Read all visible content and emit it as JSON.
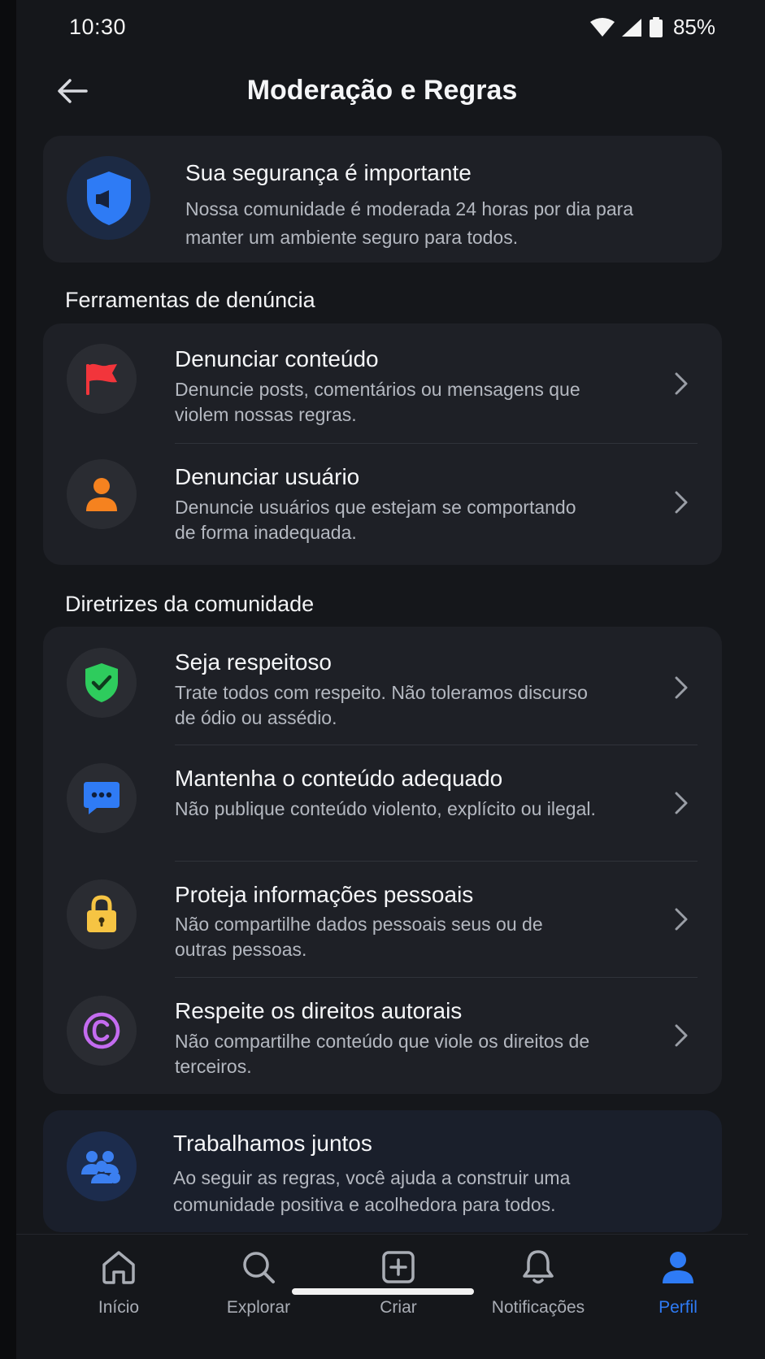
{
  "status_bar": {
    "time": "10:30",
    "battery": "85%"
  },
  "header": {
    "title": "Moderação e Regras",
    "back_icon": "arrow-left-icon"
  },
  "info_card": {
    "icon": "shield-icon",
    "title": "Sua segurança é importante",
    "description": "Nossa comunidade é moderada 24 horas por dia para manter um ambiente seguro para todos."
  },
  "report_section": {
    "title": "Ferramentas de denúncia",
    "items": [
      {
        "icon": "flag-icon",
        "icon_color": "#f2353b",
        "title": "Denunciar conteúdo",
        "description": "Denuncie posts, comentários ou mensagens que violem nossas regras."
      },
      {
        "icon": "user-icon",
        "icon_color": "#f5821f",
        "title": "Denunciar usuário",
        "description": "Denuncie usuários que estejam se comportando de forma inadequada."
      }
    ]
  },
  "guidelines_section": {
    "title": "Diretrizes da comunidade",
    "items": [
      {
        "icon": "shield-check-icon",
        "icon_color": "#2ecc5d",
        "title": "Seja respeitoso",
        "description": "Trate todos com respeito. Não toleramos discurso de ódio ou assédio."
      },
      {
        "icon": "chat-bubble-icon",
        "icon_color": "#2f7bf5",
        "title": "Mantenha o conteúdo adequado",
        "description": "Não publique conteúdo violento, explícito ou ilegal."
      },
      {
        "icon": "lock-icon",
        "icon_color": "#f6c443",
        "title": "Proteja informações pessoais",
        "description": "Não compartilhe dados pessoais seus ou de outras pessoas."
      },
      {
        "icon": "copyright-icon",
        "icon_color": "#c46cf0",
        "title": "Respeite os direitos autorais",
        "description": "Não compartilhe conteúdo que viole os direitos de terceiros."
      }
    ]
  },
  "together_card": {
    "icon": "group-icon",
    "title": "Trabalhamos juntos",
    "description": "Ao seguir as regras, você ajuda a construir uma comunidade positiva e acolhedora para todos."
  },
  "bottom_nav": {
    "items": [
      {
        "label": "Início",
        "icon": "home-icon",
        "active": false
      },
      {
        "label": "Explorar",
        "icon": "search-icon",
        "active": false
      },
      {
        "label": "Criar",
        "icon": "plus-square-icon",
        "active": false
      },
      {
        "label": "Notificações",
        "icon": "bell-icon",
        "active": false
      },
      {
        "label": "Perfil",
        "icon": "profile-icon",
        "active": true
      }
    ],
    "active_color": "#2e7bf5"
  }
}
